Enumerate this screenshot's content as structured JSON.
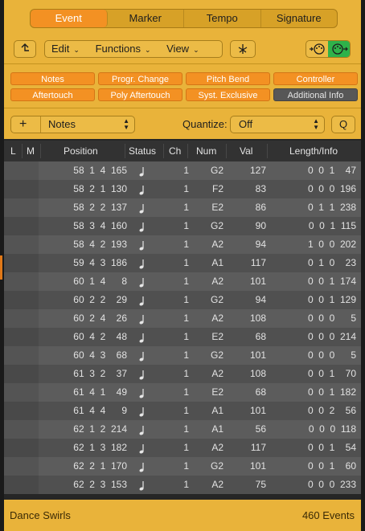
{
  "tabs": [
    {
      "label": "Event",
      "active": true
    },
    {
      "label": "Marker",
      "active": false
    },
    {
      "label": "Tempo",
      "active": false
    },
    {
      "label": "Signature",
      "active": false
    }
  ],
  "toolbar": {
    "up_icon": "arrow-up-icon",
    "menus": [
      {
        "label": "Edit"
      },
      {
        "label": "Functions"
      },
      {
        "label": "View"
      }
    ],
    "catch_icon": "catch-playhead-icon",
    "midi_in_icon": "midi-in-icon",
    "midi_out_icon": "midi-out-icon"
  },
  "filters": {
    "row1": [
      {
        "label": "Notes",
        "on": true
      },
      {
        "label": "Progr. Change",
        "on": true
      },
      {
        "label": "Pitch Bend",
        "on": true
      },
      {
        "label": "Controller",
        "on": true
      }
    ],
    "row2": [
      {
        "label": "Aftertouch",
        "on": true
      },
      {
        "label": "Poly Aftertouch",
        "on": true
      },
      {
        "label": "Syst. Exclusive",
        "on": true
      },
      {
        "label": "Additional Info",
        "on": false
      }
    ]
  },
  "create": {
    "add_label": "+",
    "type_value": "Notes",
    "quantize_label": "Quantize:",
    "quantize_value": "Off",
    "q_label": "Q"
  },
  "columns": {
    "l": "L",
    "m": "M",
    "position": "Position",
    "status": "Status",
    "ch": "Ch",
    "num": "Num",
    "val": "Val",
    "length": "Length/Info"
  },
  "rows": [
    {
      "pos": "58  1  4  165",
      "ch": "1",
      "num": "G2",
      "val": "127",
      "len": "0  0  1    47"
    },
    {
      "pos": "58  2  1  130",
      "ch": "1",
      "num": "F2",
      "val": "83",
      "len": "0  0  0  196"
    },
    {
      "pos": "58  2  2  137",
      "ch": "1",
      "num": "E2",
      "val": "86",
      "len": "0  1  1  238"
    },
    {
      "pos": "58  3  4  160",
      "ch": "1",
      "num": "G2",
      "val": "90",
      "len": "0  0  1  115"
    },
    {
      "pos": "58  4  2  193",
      "ch": "1",
      "num": "A2",
      "val": "94",
      "len": "1  0  0  202"
    },
    {
      "pos": "59  4  3  186",
      "ch": "1",
      "num": "A1",
      "val": "117",
      "len": "0  1  0    23"
    },
    {
      "pos": "60  1  4      8",
      "ch": "1",
      "num": "A2",
      "val": "101",
      "len": "0  0  1  174"
    },
    {
      "pos": "60  2  2    29",
      "ch": "1",
      "num": "G2",
      "val": "94",
      "len": "0  0  1  129"
    },
    {
      "pos": "60  2  4    26",
      "ch": "1",
      "num": "A2",
      "val": "108",
      "len": "0  0  0      5"
    },
    {
      "pos": "60  4  2    48",
      "ch": "1",
      "num": "E2",
      "val": "68",
      "len": "0  0  0  214"
    },
    {
      "pos": "60  4  3    68",
      "ch": "1",
      "num": "G2",
      "val": "101",
      "len": "0  0  0      5"
    },
    {
      "pos": "61  3  2    37",
      "ch": "1",
      "num": "A2",
      "val": "108",
      "len": "0  0  1    70"
    },
    {
      "pos": "61  4  1    49",
      "ch": "1",
      "num": "E2",
      "val": "68",
      "len": "0  0  1  182"
    },
    {
      "pos": "61  4  4      9",
      "ch": "1",
      "num": "A1",
      "val": "101",
      "len": "0  0  2    56"
    },
    {
      "pos": "62  1  2  214",
      "ch": "1",
      "num": "A1",
      "val": "56",
      "len": "0  0  0  118"
    },
    {
      "pos": "62  1  3  182",
      "ch": "1",
      "num": "A2",
      "val": "117",
      "len": "0  0  1    54"
    },
    {
      "pos": "62  2  1  170",
      "ch": "1",
      "num": "G2",
      "val": "101",
      "len": "0  0  1    60"
    },
    {
      "pos": "62  2  3  153",
      "ch": "1",
      "num": "A2",
      "val": "75",
      "len": "0  0  0  233"
    }
  ],
  "status_icon": "quarter-note-icon",
  "footer": {
    "region": "Dance Swirls",
    "count": "460 Events"
  }
}
